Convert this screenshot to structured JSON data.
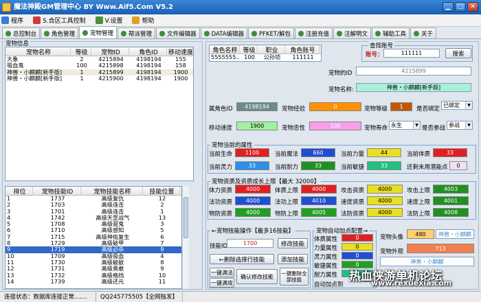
{
  "window": {
    "title": "魔法神殿GM管理中心 BY Www.Aif5.Com  V5.2"
  },
  "menu": [
    {
      "label": "程序",
      "color": "#3a7bd5"
    },
    {
      "label": "S.合区工具控制",
      "color": "#d23b3b"
    },
    {
      "label": "V.设置",
      "color": "#4a8f3c"
    },
    {
      "label": "帮助",
      "color": "#e0a020"
    }
  ],
  "tabs": [
    "总控制台",
    "角色管理",
    "宠物管理",
    "帮派管理",
    "文件编辑器",
    "DATA编辑器",
    "PFKET/解包",
    "注册充值",
    "注解明文",
    "辅助工具",
    "关于"
  ],
  "active_tab": 2,
  "pet_info": {
    "label": "宠物信息",
    "headers": [
      "宠物名称",
      "等级",
      "宠物ID",
      "角色ID",
      "移动速度"
    ],
    "rows": [
      [
        "大象",
        "2",
        "4215894",
        "4198194",
        "155"
      ],
      [
        "吸血鬼",
        "100",
        "4215898",
        "4198194",
        "158"
      ],
      [
        "神兽・小麒麟[新手版]",
        "1",
        "4215899",
        "4198194",
        "1900"
      ],
      [
        "神兽・小麒麟[新手版]",
        "1",
        "4215900",
        "4198194",
        "1900"
      ]
    ]
  },
  "skills": {
    "headers": [
      "排位",
      "宠物技能ID",
      "宠物技能名称",
      "技能位置"
    ],
    "selected": 8,
    "rows": [
      [
        "1",
        "1737",
        "高级复仇",
        "12"
      ],
      [
        "2",
        "1703",
        "高级连击",
        "2"
      ],
      [
        "3",
        "1701",
        "高级连击",
        "1"
      ],
      [
        "4",
        "1742",
        "高级天罡战气",
        "13"
      ],
      [
        "5",
        "1708",
        "高级驱鬼",
        "3"
      ],
      [
        "6",
        "1710",
        "高级感知",
        "5"
      ],
      [
        "7",
        "1715",
        "高级神佑复生",
        "6"
      ],
      [
        "8",
        "1729",
        "高级破甲",
        "7"
      ],
      [
        "9",
        "1719",
        "高级必杀",
        "9"
      ],
      [
        "10",
        "1709",
        "高级吸血",
        "4"
      ],
      [
        "11",
        "1730",
        "高级破敌",
        "8"
      ],
      [
        "12",
        "1731",
        "高级勇敢",
        "9"
      ],
      [
        "13",
        "1732",
        "高级格挡",
        "10"
      ],
      [
        "14",
        "1739",
        "高级还元",
        "11"
      ]
    ]
  },
  "owner": {
    "headers": [
      "角色名称",
      "等级",
      "职业",
      "角色账号"
    ],
    "row": [
      "5555555...",
      "100",
      "公孙坊",
      "111111"
    ]
  },
  "search": {
    "label": "查找账号",
    "account_label": "账号：",
    "account_value": "111111",
    "button": "搜索"
  },
  "pet_id": {
    "label": "宠物的ID",
    "value": "4215899"
  },
  "pet_name": {
    "label": "宠物名称:",
    "value": "神兽・小麒麟[新手版]"
  },
  "row1": {
    "owner_id_label": "属角色ID",
    "owner_id": "4198194",
    "exp_label": "宠物经验",
    "exp": "0",
    "level_label": "宠物等级",
    "level": "1",
    "bind_label": "是否绑定",
    "bind": "已绑定"
  },
  "row2": {
    "speed_label": "移动速度",
    "speed": "1900",
    "loyal_label": "宠物忠性",
    "loyal": "100",
    "life_label": "宠物寿命",
    "life": "永生",
    "battle_label": "是否参战",
    "battle": "参战"
  },
  "current_attrs": {
    "title": "宠物当前的属性",
    "items": [
      {
        "label": "当前生命",
        "value": "1100",
        "color": "#e02020",
        "fg": "#fff"
      },
      {
        "label": "当前魔法",
        "value": "660",
        "color": "#1e4fd0",
        "fg": "#fff"
      },
      {
        "label": "当前力量",
        "value": "44",
        "color": "#e8e020",
        "fg": "#000"
      },
      {
        "label": "当前体质",
        "value": "33",
        "color": "#e02020",
        "fg": "#fff"
      },
      {
        "label": "当前灵力",
        "value": "33",
        "color": "#2f8fe8",
        "fg": "#fff"
      },
      {
        "label": "当前耐力",
        "value": "33",
        "color": "#209020",
        "fg": "#fff"
      },
      {
        "label": "当前敏捷",
        "value": "33",
        "color": "#20c080",
        "fg": "#fff"
      },
      {
        "label": "还剩未用潜能点",
        "value": "0",
        "color": "#f0e0f0",
        "fg": "#000"
      }
    ]
  },
  "growth": {
    "title": "宠物资质及资质成长上限【最大 32000】",
    "items": [
      {
        "label": "体力资质",
        "value": "4000",
        "color": "#e02020",
        "fg": "#fff"
      },
      {
        "label": "体质上限",
        "value": "4000",
        "color": "#e02020",
        "fg": "#fff"
      },
      {
        "label": "攻击资质",
        "value": "4000",
        "color": "#e8e020",
        "fg": "#000"
      },
      {
        "label": "攻击上限",
        "value": "4003",
        "color": "#209020",
        "fg": "#fff"
      },
      {
        "label": "法功资质",
        "value": "4000",
        "color": "#1e4fd0",
        "fg": "#fff"
      },
      {
        "label": "法功上限",
        "value": "4010",
        "color": "#1e4fd0",
        "fg": "#fff"
      },
      {
        "label": "速度资质",
        "value": "4000",
        "color": "#e8e020",
        "fg": "#000"
      },
      {
        "label": "速度上限",
        "value": "4001",
        "color": "#209020",
        "fg": "#fff"
      },
      {
        "label": "物防资质",
        "value": "4000",
        "color": "#20a020",
        "fg": "#fff"
      },
      {
        "label": "物防上限",
        "value": "4005",
        "color": "#20a020",
        "fg": "#fff"
      },
      {
        "label": "法防资质",
        "value": "4000",
        "color": "#e8e020",
        "fg": "#000"
      },
      {
        "label": "法防上限",
        "value": "4008",
        "color": "#209020",
        "fg": "#fff"
      }
    ]
  },
  "skill_ops": {
    "title": "←宠物技能操作【最多16技能】",
    "skill_id_label": "技能ID:",
    "skill_id": "1700",
    "modify": "修改技能",
    "delete_selected": "←删除选择行技能",
    "add": "添加技能",
    "full_full": "一键满法",
    "full_attack": "一键满攻",
    "confirm": "确认修改技能",
    "delete_all": "一键删除全部技能"
  },
  "auto_points": {
    "title": "宠物自动加点配置→",
    "items": [
      {
        "label": "体质属性",
        "value": "0",
        "color": "#e02020"
      },
      {
        "label": "力量属性",
        "value": "0",
        "color": "#e8e020"
      },
      {
        "label": "灵力属性",
        "value": "0",
        "color": "#1e4fd0"
      },
      {
        "label": "敏捷属性",
        "value": "0",
        "color": "#20a020"
      },
      {
        "label": "耐力属性",
        "value": "0",
        "color": "#20c080"
      }
    ],
    "auto_label": "自动加点到"
  },
  "appearance": {
    "head_label": "宠物头像",
    "head_value": "480",
    "head_name": "神兽・小麒麟",
    "look_label": "宠物外观",
    "look_value": "713",
    "look_name": "神兽・小麒麟"
  },
  "status": {
    "connection": "连接状态：数据库连接正常.......",
    "qq": "QQ245775505【全网独发】"
  },
  "watermark": {
    "line1": "热血侠游单机论坛",
    "line2": "www.rexuexia.com"
  }
}
